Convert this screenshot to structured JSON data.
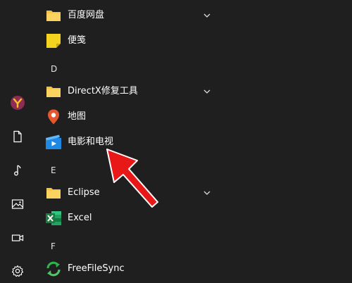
{
  "rail": {
    "items": [
      {
        "name": "user-avatar",
        "icon": "user-avatar-icon"
      },
      {
        "name": "documents",
        "icon": "document-icon"
      },
      {
        "name": "music",
        "icon": "music-note-icon"
      },
      {
        "name": "pictures",
        "icon": "picture-icon"
      },
      {
        "name": "videos",
        "icon": "video-camera-icon"
      },
      {
        "name": "settings",
        "icon": "gear-icon"
      }
    ]
  },
  "apps": {
    "baidu_pan": {
      "label": "百度网盘",
      "icon": "folder-icon",
      "expandable": true
    },
    "sticky_notes": {
      "label": "便笺",
      "icon": "sticky-note-icon"
    },
    "section_d": "D",
    "directx": {
      "label": "DirectX修复工具",
      "icon": "folder-icon",
      "expandable": true
    },
    "maps": {
      "label": "地图",
      "icon": "map-pin-icon"
    },
    "movies_tv": {
      "label": "电影和电视",
      "icon": "movies-tv-icon"
    },
    "section_e": "E",
    "eclipse": {
      "label": "Eclipse",
      "icon": "folder-icon",
      "expandable": true
    },
    "excel": {
      "label": "Excel",
      "icon": "excel-icon"
    },
    "section_f": "F",
    "freefilesync": {
      "label": "FreeFileSync",
      "icon": "sync-icon"
    }
  },
  "colors": {
    "background": "#1f1f1f",
    "folder": "#f6c142",
    "sticky": "#f5d31f",
    "maps": "#e4572e",
    "movies": "#1e88e5",
    "excel": "#1d7a43",
    "sync": "#2fb24c",
    "arrow": "#e81818"
  }
}
